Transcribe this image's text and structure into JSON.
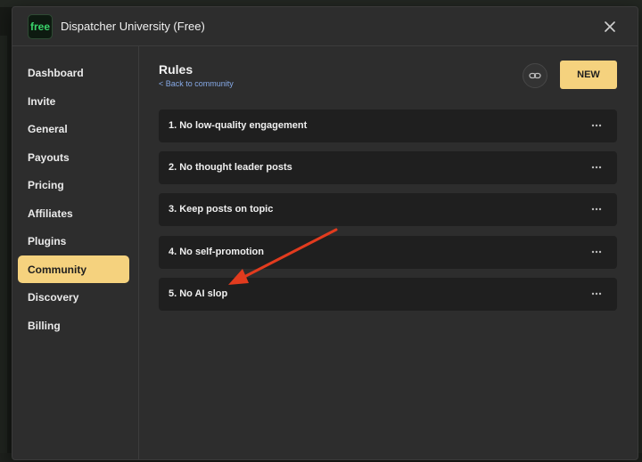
{
  "app": {
    "logo_text": "free",
    "title": "Dispatcher University (Free)"
  },
  "sidebar": {
    "items": [
      {
        "label": "Dashboard",
        "active": false
      },
      {
        "label": "Invite",
        "active": false
      },
      {
        "label": "General",
        "active": false
      },
      {
        "label": "Payouts",
        "active": false
      },
      {
        "label": "Pricing",
        "active": false
      },
      {
        "label": "Affiliates",
        "active": false
      },
      {
        "label": "Plugins",
        "active": false
      },
      {
        "label": "Community",
        "active": true
      },
      {
        "label": "Discovery",
        "active": false
      },
      {
        "label": "Billing",
        "active": false
      }
    ]
  },
  "main": {
    "title": "Rules",
    "back_link": "< Back to community",
    "new_button": "NEW",
    "rules": [
      {
        "label": "1. No low-quality engagement"
      },
      {
        "label": "2. No thought leader posts"
      },
      {
        "label": "3. Keep posts on topic"
      },
      {
        "label": "4. No self-promotion"
      },
      {
        "label": "5. No AI slop"
      }
    ]
  },
  "colors": {
    "accent": "#f5d27e",
    "modal_bg": "#2d2d2d",
    "row_bg": "#1f1f1f",
    "annotation_arrow": "#e23b1e"
  }
}
